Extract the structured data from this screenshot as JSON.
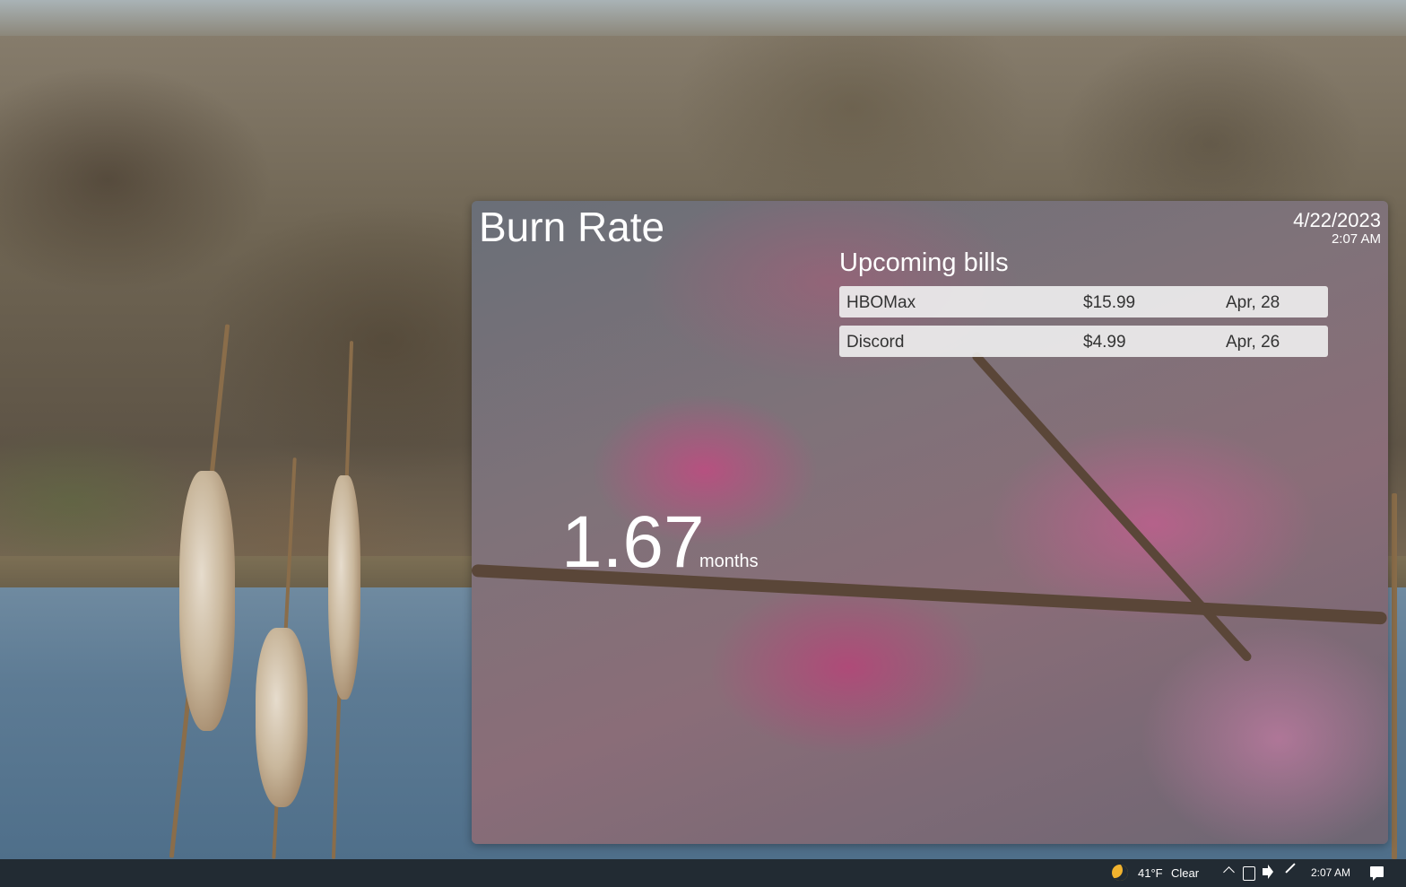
{
  "widget": {
    "title": "Burn Rate",
    "date": "4/22/2023",
    "time": "2:07 AM",
    "burn_value": "1.67",
    "burn_unit": "months",
    "bills_heading": "Upcoming bills",
    "bills": [
      {
        "name": "HBOMax",
        "amount": "$15.99",
        "due": "Apr, 28"
      },
      {
        "name": "Discord",
        "amount": "$4.99",
        "due": "Apr, 26"
      }
    ]
  },
  "taskbar": {
    "weather_icon": "moon-icon",
    "temperature": "41°F",
    "condition": "Clear",
    "clock": "2:07 AM",
    "tray_icons": [
      "chevron-up-icon",
      "meet-now-icon",
      "volume-icon",
      "pen-icon",
      "notification-icon"
    ]
  },
  "colors": {
    "taskbar_bg": "#222b33",
    "bill_row_bg": "#f0f0f0",
    "accent_moon": "#f2b32e"
  }
}
